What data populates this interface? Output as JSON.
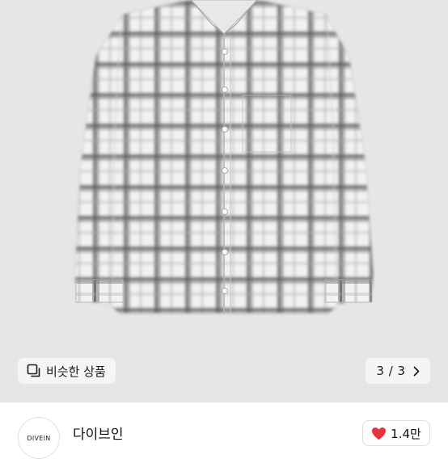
{
  "product": {
    "image_description": "grey and white plaid long-sleeve button-up shirt"
  },
  "overlay": {
    "similar_button_label": "비슷한 상품",
    "similar_icon": "copy-icon",
    "counter_text": "3 / 3",
    "next_icon": "chevron-right-icon"
  },
  "seller": {
    "logo_text": "DIVEIN",
    "name": "다이브인"
  },
  "like": {
    "icon": "heart-icon",
    "count": "1.4만",
    "color": "#e8333d"
  }
}
